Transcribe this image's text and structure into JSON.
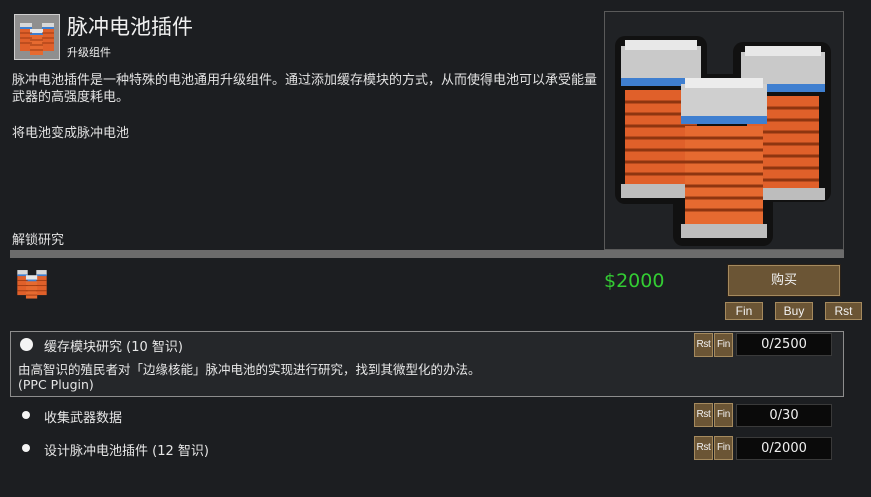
{
  "header": {
    "icon": "battery-coils-icon",
    "title": "脉冲电池插件",
    "subtitle": "升级组件"
  },
  "description": "脉冲电池插件是一种特殊的电池通用升级组件。通过添加缓存模块的方式，从而使得电池可以承受能量武器的高强度耗电。",
  "effect": "将电池变成脉冲电池",
  "unlock": {
    "label": "解锁研究",
    "progress": 0
  },
  "purchase": {
    "price": "$2000",
    "buy_label": "购买",
    "debug_fin": "Fin",
    "debug_buy": "Buy",
    "debug_rst": "Rst"
  },
  "projects": [
    {
      "label": "缓存模块研究 (10 智识)",
      "desc_line1": "由高智识的殖民者对「边缘核能」脉冲电池的实现进行研究，找到其微型化的办法。",
      "desc_line2": "(PPC Plugin)",
      "rst": "Rst",
      "fin": "Fin",
      "counter": "0/2500"
    },
    {
      "label": "收集武器数据",
      "rst": "Rst",
      "fin": "Fin",
      "counter": "0/30"
    },
    {
      "label": "设计脉冲电池插件 (12 智识)",
      "rst": "Rst",
      "fin": "Fin",
      "counter": "0/2000"
    }
  ],
  "colors": {
    "price": "#33cc33",
    "button": "#6b5535",
    "coil": "#e0602a",
    "band": "#3f7fd0"
  }
}
